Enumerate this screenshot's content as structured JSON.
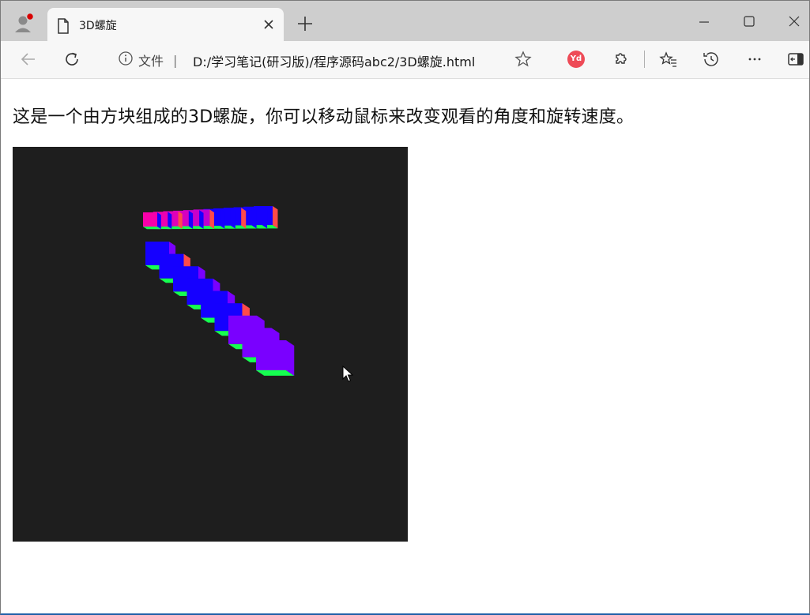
{
  "browser": {
    "tab_title": "3D螺旋",
    "address": {
      "site_label": "文件",
      "url": "D:/学习笔记(研习版)/程序源码abc2/3D螺旋.html"
    },
    "extension_badge": "Yd"
  },
  "page": {
    "description": "这是一个由方块组成的3D螺旋，你可以移动鼠标来改变观看的角度和旋转速度。"
  },
  "colors": {
    "canvas_bg": "#1e1e1e",
    "cube_face_blue": "#1500ff",
    "cube_face_green": "#15ff50",
    "cube_face_red": "#ff4a4a",
    "cube_face_purple": "#7a00ff"
  },
  "icons": [
    "profile-icon",
    "page-icon",
    "close-icon",
    "new-tab-icon",
    "minimize-icon",
    "maximize-icon",
    "window-close-icon",
    "back-icon",
    "refresh-icon",
    "info-icon",
    "favorite-star-icon",
    "extensions-icon",
    "favorites-icon",
    "history-icon",
    "more-icon",
    "sidebar-icon",
    "mouse-cursor-icon"
  ]
}
